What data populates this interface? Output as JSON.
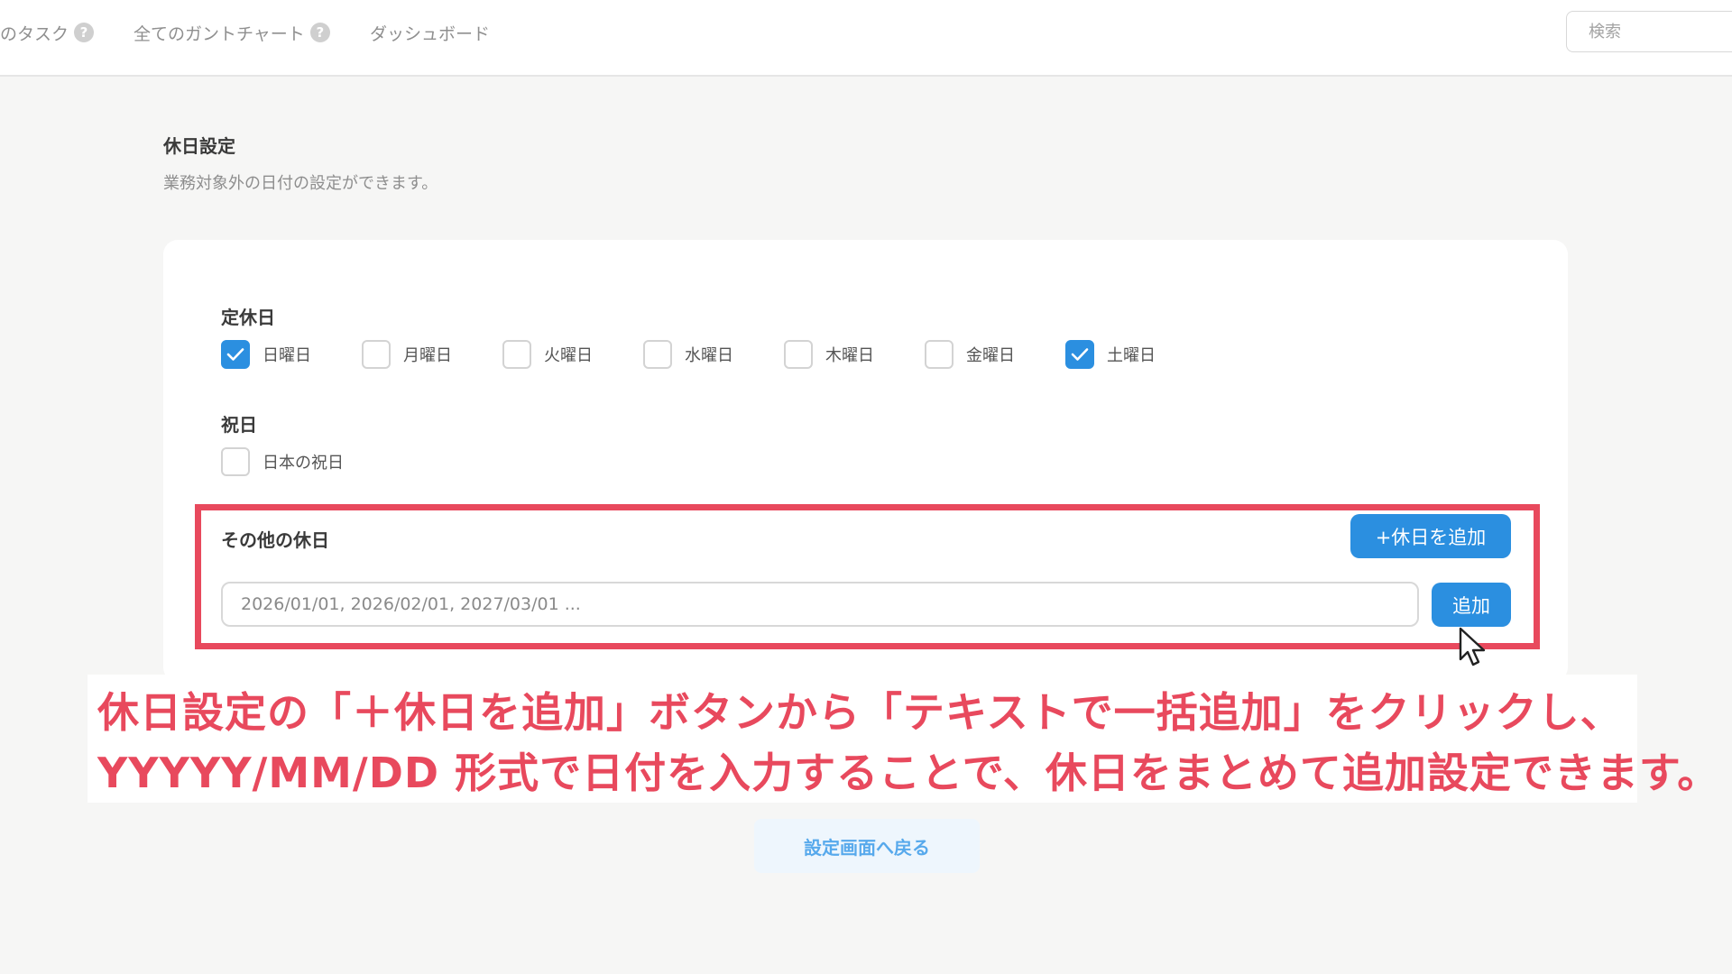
{
  "nav": {
    "items": [
      {
        "label": "のタスク",
        "help": "?"
      },
      {
        "label": "全てのガントチャート",
        "help": "?"
      },
      {
        "label": "ダッシュボード"
      }
    ],
    "search_placeholder": "検索"
  },
  "page": {
    "title": "休日設定",
    "description": "業務対象外の日付の設定ができます。"
  },
  "regular_holidays": {
    "label": "定休日",
    "days": [
      {
        "label": "日曜日",
        "checked": true
      },
      {
        "label": "月曜日",
        "checked": false
      },
      {
        "label": "火曜日",
        "checked": false
      },
      {
        "label": "水曜日",
        "checked": false
      },
      {
        "label": "木曜日",
        "checked": false
      },
      {
        "label": "金曜日",
        "checked": false
      },
      {
        "label": "土曜日",
        "checked": true
      }
    ]
  },
  "public_holidays": {
    "label": "祝日",
    "option": {
      "label": "日本の祝日",
      "checked": false
    }
  },
  "other_holidays": {
    "label": "その他の休日",
    "add_holiday_button": "+休日を追加",
    "input_placeholder": "2026/01/01, 2026/02/01, 2027/03/01 ...",
    "add_button": "追加"
  },
  "caption": {
    "line1": "休日設定の「＋休日を追加」ボタンから「テキストで一括追加」をクリックし、",
    "line2": "YYYYY/MM/DD 形式で日付を入力することで、休日をまとめて追加設定できます。"
  },
  "back_button": "設定画面へ戻る",
  "colors": {
    "accent": "#2b8fe0",
    "highlight": "#e8495d"
  }
}
